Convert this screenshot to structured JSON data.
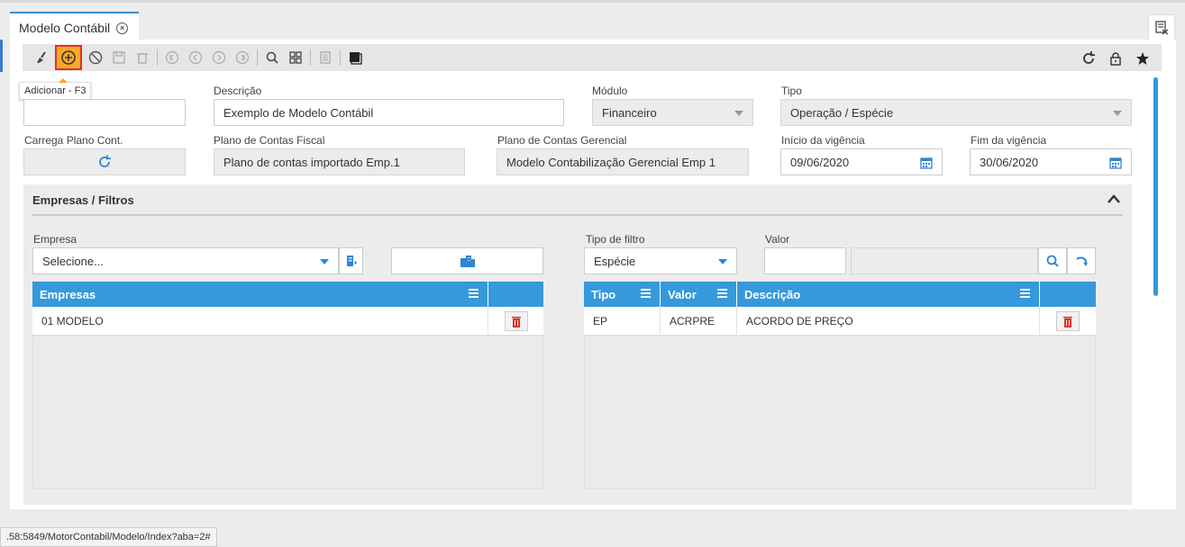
{
  "tab": {
    "title": "Modelo Contábil"
  },
  "toolbar": {
    "tooltip": "Adicionar - F3"
  },
  "form": {
    "codigo": {
      "value": ""
    },
    "descricao": {
      "label": "Descrição",
      "value": "Exemplo de Modelo Contábil"
    },
    "modulo": {
      "label": "Módulo",
      "value": "Financeiro"
    },
    "tipo": {
      "label": "Tipo",
      "value": "Operação / Espécie"
    },
    "carrega_plano": {
      "label": "Carrega Plano Cont."
    },
    "plano_fiscal": {
      "label": "Plano de Contas Fiscal",
      "value": "Plano de contas importado Emp.1"
    },
    "plano_gerencial": {
      "label": "Plano de Contas Gerencial",
      "value": "Modelo Contabilização Gerencial Emp 1"
    },
    "inicio_vigencia": {
      "label": "Início da vigência",
      "value": "09/06/2020"
    },
    "fim_vigencia": {
      "label": "Fim da vigência",
      "value": "30/06/2020"
    }
  },
  "section": {
    "title": "Empresas / Filtros",
    "empresa": {
      "label": "Empresa",
      "value": "Selecione..."
    },
    "tipo_filtro": {
      "label": "Tipo de filtro",
      "value": "Espécie"
    },
    "valor": {
      "label": "Valor",
      "value": ""
    },
    "grid_empresas": {
      "headers": [
        "Empresas"
      ],
      "rows": [
        {
          "empresa": "01 MODELO"
        }
      ]
    },
    "grid_filtros": {
      "headers": [
        "Tipo",
        "Valor",
        "Descrição"
      ],
      "rows": [
        {
          "tipo": "EP",
          "valor": "ACRPRE",
          "descricao": "ACORDO DE PREÇO"
        }
      ]
    }
  },
  "status": {
    "url": ".58:5849/MotorContabil/Modelo/Index?aba=2#"
  },
  "colors": {
    "accent": "#3599db",
    "highlight": "#f7a928",
    "danger": "#e0312a"
  }
}
